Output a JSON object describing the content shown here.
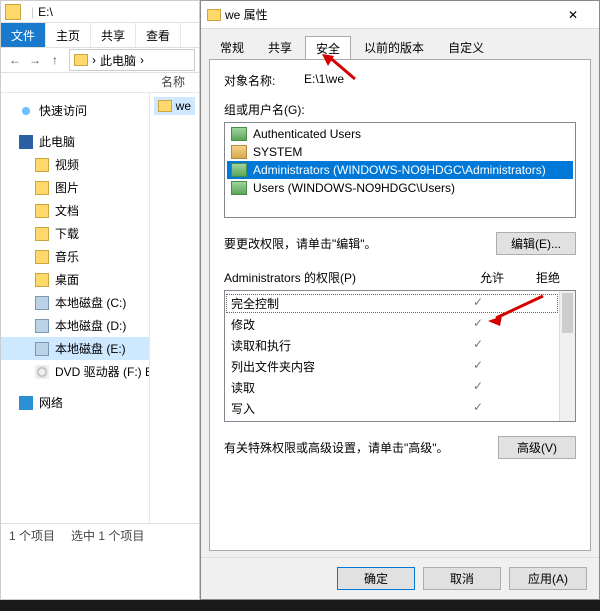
{
  "explorer": {
    "drive_label": "E:\\",
    "ribbon": {
      "file": "文件",
      "home": "主页",
      "share": "共享",
      "view": "查看"
    },
    "breadcrumb": {
      "sep": "›",
      "thispc": "此电脑"
    },
    "col_name": "名称",
    "nav": {
      "quick": "快速访问",
      "thispc": "此电脑",
      "video": "视频",
      "pictures": "图片",
      "documents": "文档",
      "downloads": "下载",
      "music": "音乐",
      "desktop": "桌面",
      "drive_c": "本地磁盘 (C:)",
      "drive_d": "本地磁盘 (D:)",
      "drive_e": "本地磁盘 (E:)",
      "dvd": "DVD 驱动器 (F:) Bo",
      "network": "网络"
    },
    "file_we": "we",
    "status": {
      "count": "1 个项目",
      "selected": "选中 1 个项目"
    }
  },
  "dlg": {
    "title": "we 属性",
    "tabs": {
      "general": "常规",
      "share": "共享",
      "security": "安全",
      "prev": "以前的版本",
      "custom": "自定义"
    },
    "obj_label": "对象名称:",
    "obj_value": "E:\\1\\we",
    "groups_label": "组或用户名(G):",
    "groups": {
      "g0": "Authenticated Users",
      "g1": "SYSTEM",
      "g2": "Administrators (WINDOWS-NO9HDGC\\Administrators)",
      "g3": "Users (WINDOWS-NO9HDGC\\Users)"
    },
    "edit_hint": "要更改权限，请单击\"编辑\"。",
    "edit_btn": "编辑(E)...",
    "perm_for": "Administrators 的权限(P)",
    "allow": "允许",
    "deny": "拒绝",
    "perms": {
      "p0": "完全控制",
      "p1": "修改",
      "p2": "读取和执行",
      "p3": "列出文件夹内容",
      "p4": "读取",
      "p5": "写入"
    },
    "adv_hint": "有关特殊权限或高级设置，请单击\"高级\"。",
    "adv_btn": "高级(V)",
    "ok": "确定",
    "cancel": "取消",
    "apply": "应用(A)"
  },
  "check": "✓"
}
